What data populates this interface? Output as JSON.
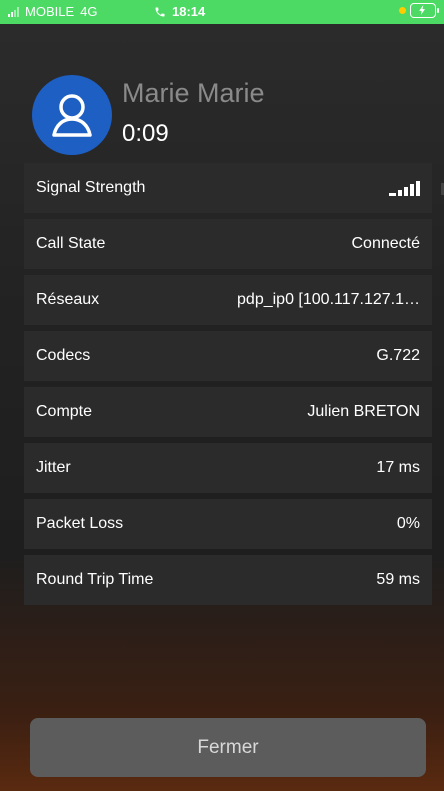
{
  "status_bar": {
    "carrier": "MOBILE",
    "network": "4G",
    "time": "18:14",
    "color": "#4cd964"
  },
  "caller": {
    "name": "Marie Marie",
    "duration": "0:09",
    "avatar_icon": "person-icon",
    "avatar_color": "#1e5fc4"
  },
  "stats": [
    {
      "label": "Signal Strength",
      "value": "",
      "icon": "signal-bars-icon"
    },
    {
      "label": "Call State",
      "value": "Connecté"
    },
    {
      "label": "Réseaux",
      "value": "pdp_ip0 [100.117.127.1…"
    },
    {
      "label": "Codecs",
      "value": "G.722"
    },
    {
      "label": "Compte",
      "value": "Julien BRETON"
    },
    {
      "label": "Jitter",
      "value": "17 ms"
    },
    {
      "label": "Packet Loss",
      "value": "0%"
    },
    {
      "label": "Round Trip Time",
      "value": "59 ms"
    }
  ],
  "close_button": {
    "label": "Fermer"
  }
}
